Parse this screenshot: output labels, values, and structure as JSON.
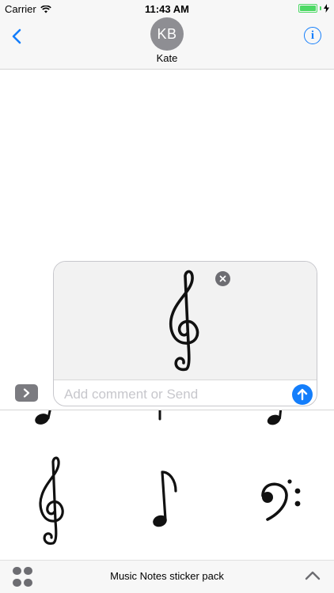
{
  "status_bar": {
    "carrier": "Carrier",
    "time": "11:43 AM",
    "battery_level": 1.0
  },
  "header": {
    "avatar_initials": "KB",
    "contact_name": "Kate",
    "back_icon": "chevron-left-icon",
    "info_icon": "info-icon"
  },
  "compose": {
    "placeholder": "Add comment or Send",
    "value": "",
    "attached_sticker": "treble-clef"
  },
  "drawer": {
    "stickers": [
      "eighth-note",
      "quarter-note",
      "quarter-note",
      "treble-clef",
      "eighth-note",
      "bass-clef"
    ]
  },
  "bottom_bar": {
    "title": "Music Notes sticker pack"
  },
  "colors": {
    "accent": "#147efb",
    "battery": "#4cd964",
    "avatar": "#8e8e93",
    "bar_background": "#f7f7f7"
  }
}
